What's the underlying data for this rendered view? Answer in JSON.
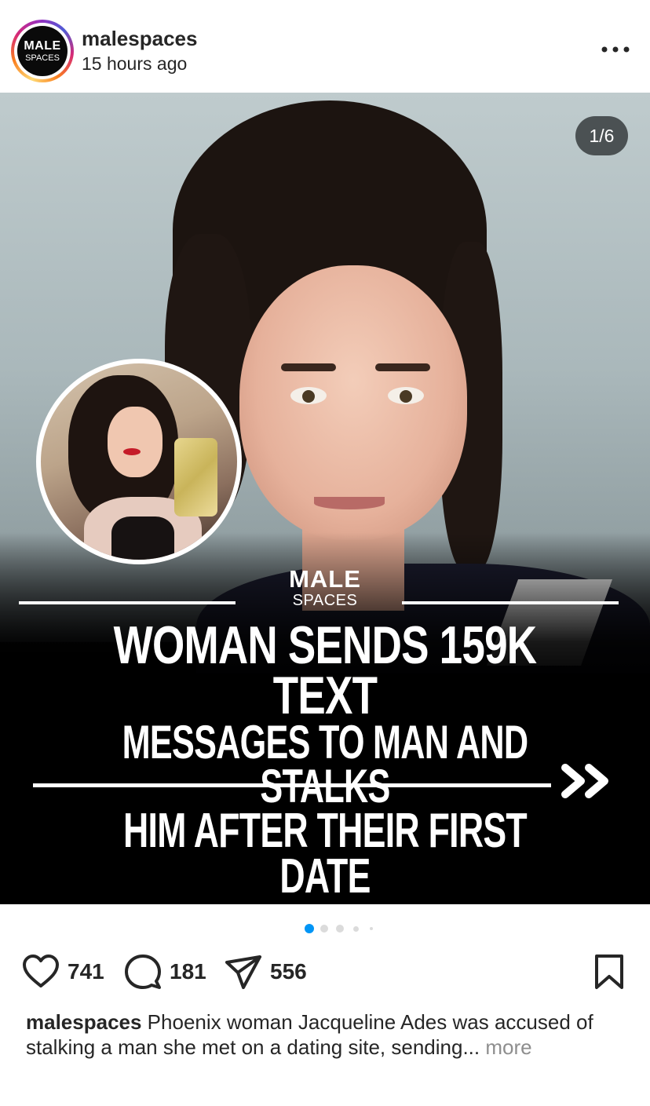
{
  "post": {
    "username": "malespaces",
    "time_ago": "15 hours ago",
    "avatar": {
      "line1": "MALE",
      "line2": "SPACES"
    },
    "more_icon": "more-dots-icon"
  },
  "media": {
    "counter": "1/6",
    "brand_line1": "MALE",
    "brand_line2": "SPACES",
    "headline": [
      "WOMAN SENDS 159K TEXT",
      "MESSAGES TO MAN AND STALKS",
      "HIM AFTER THEIR FIRST DATE"
    ],
    "next_glyph": "»",
    "carousel": {
      "total": 6,
      "current": 1,
      "visible_dots": 5,
      "active_color": "#0095f6",
      "inactive_color": "#dbdbdb"
    }
  },
  "actions": {
    "likes": "741",
    "comments": "181",
    "shares": "556",
    "icons": [
      "heart-icon",
      "comment-icon",
      "share-icon",
      "bookmark-icon"
    ]
  },
  "caption": {
    "username": "malespaces",
    "text": " Phoenix woman Jacqueline Ades was accused of stalking a man she met on a dating site, sending...",
    "more": " more"
  }
}
